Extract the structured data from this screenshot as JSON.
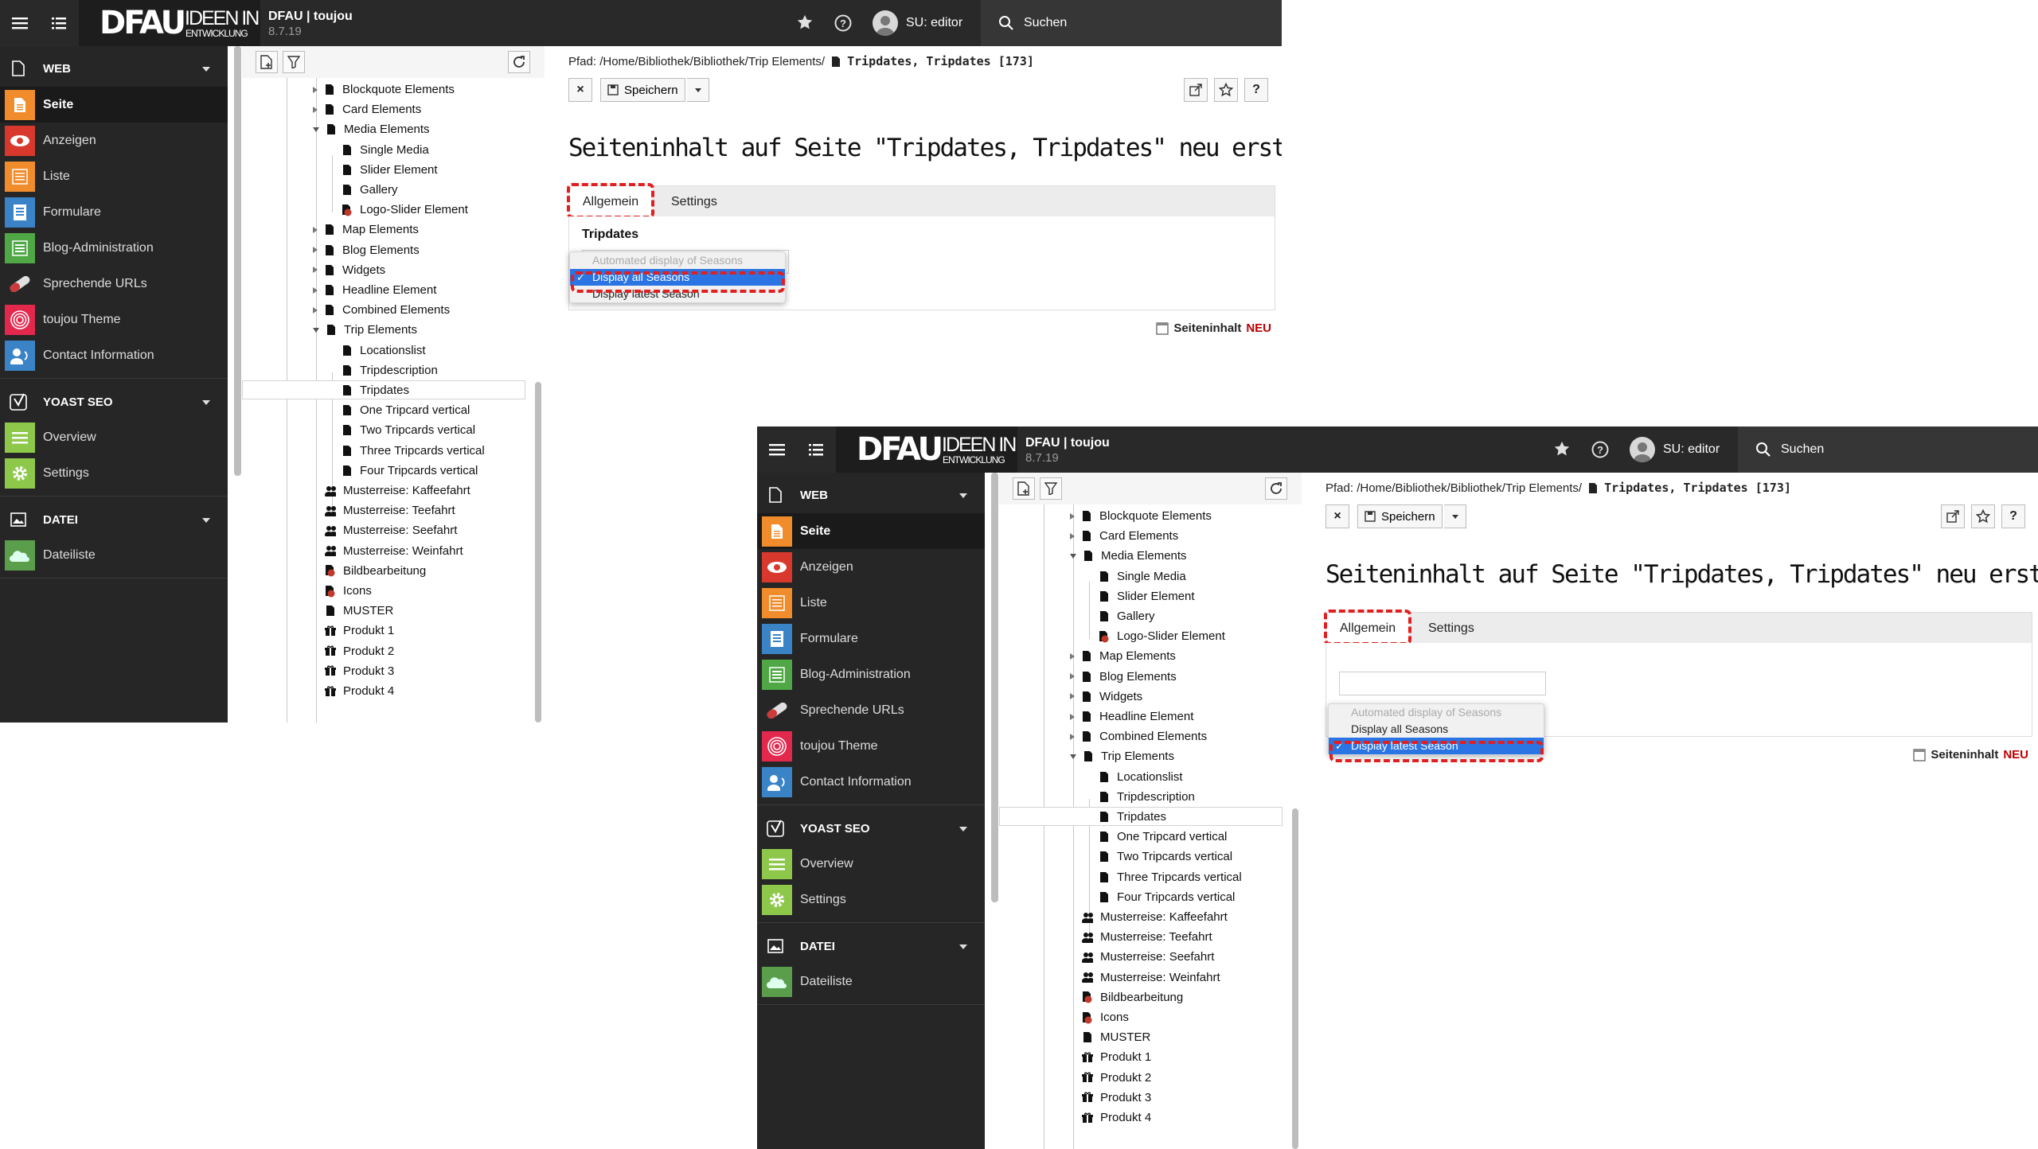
{
  "topbar": {
    "logo_main": "DFAU",
    "logo_line1": "IDEEN IN",
    "logo_line2": "ENTWICKLUNG",
    "site_name": "DFAU | toujou",
    "version": "8.7.19",
    "user": "SU: editor",
    "search_label": "Suchen"
  },
  "modules": {
    "web_group": "WEB",
    "web_items": [
      "Seite",
      "Anzeigen",
      "Liste",
      "Formulare",
      "Blog-Administration",
      "Sprechende URLs",
      "toujou Theme",
      "Contact Information"
    ],
    "yoast_group": "YOAST SEO",
    "yoast_items": [
      "Overview",
      "Settings"
    ],
    "datei_group": "DATEI",
    "datei_items": [
      "Dateiliste"
    ]
  },
  "tree": {
    "nodes": [
      "Blockquote Elements",
      "Card Elements",
      "Media Elements",
      "Single Media",
      "Slider Element",
      "Gallery",
      "Logo-Slider Element",
      "Map Elements",
      "Blog Elements",
      "Widgets",
      "Headline Element",
      "Combined Elements",
      "Trip Elements",
      "Locationslist",
      "Tripdescription",
      "Tripdates",
      "One Tripcard vertical",
      "Two Tripcards vertical",
      "Three Tripcards vertical",
      "Four Tripcards vertical",
      "Musterreise: Kaffeefahrt",
      "Musterreise: Teefahrt",
      "Musterreise: Seefahrt",
      "Musterreise: Weinfahrt",
      "Bildbearbeitung",
      "Icons",
      "MUSTER",
      "Produkt 1",
      "Produkt 2",
      "Produkt 3",
      "Produkt 4"
    ]
  },
  "content": {
    "path_label": "Pfad: /Home/Bibliothek/Bibliothek/Trip Elements/",
    "path_title": "Tripdates, Tripdates [173]",
    "save_label": "Speichern",
    "close_label": "×",
    "help_label": "?",
    "heading": "Seiteninhalt auf Seite \"Tripdates, Tripdates\" neu erstellen",
    "tab_general": "Allgemein",
    "tab_settings": "Settings",
    "field_label": "Tripdates",
    "options": [
      "Automated display of Seasons",
      "Display all Seasons",
      "Display latest Season"
    ],
    "check_mark": "✓",
    "new_content_label": "Seiteninhalt",
    "new_badge": "NEU"
  },
  "screenshot1": {
    "selected_option": "Display all Seasons"
  },
  "screenshot2": {
    "selected_option": "Display latest Season"
  },
  "colors": {
    "topbar": "#292929",
    "module_menu": "#262626",
    "seite": "#f08c2b",
    "anzeigen": "#d9392d",
    "liste": "#f08c2b",
    "formulare": "#3a83c7",
    "blog": "#4fa845",
    "urls": "#cc3b3b",
    "theme": "#e3284e",
    "contact": "#3a83c7",
    "yoast": "#8dc84a",
    "dateiliste": "#5a9e4b",
    "highlight": "#e02020",
    "selection": "#2a74e3"
  }
}
